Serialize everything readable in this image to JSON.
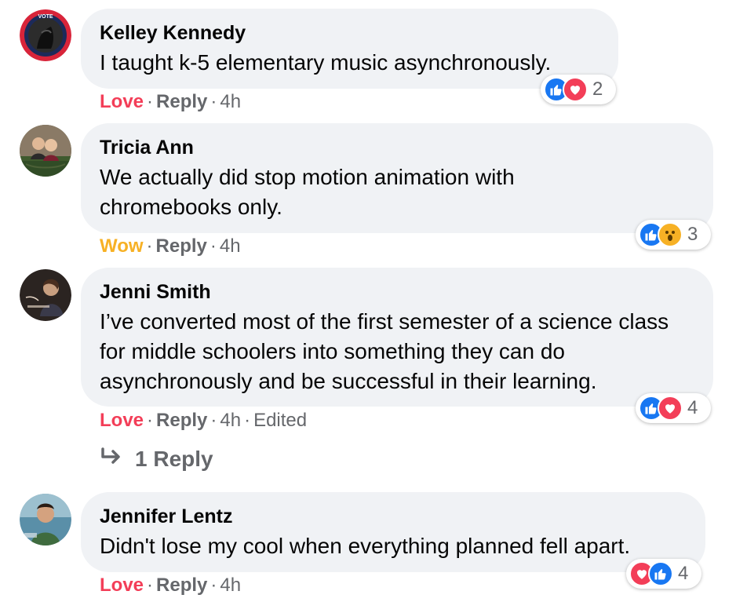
{
  "comments": [
    {
      "author": "Kelley Kennedy",
      "text": "I taught k-5 elementary music asynchronously.",
      "reaction_label": "Love",
      "reply_label": "Reply",
      "time": "4h",
      "edited": "",
      "reaction_icons": [
        "like",
        "love"
      ],
      "reaction_count": "2",
      "avatar_badge": "VOTE"
    },
    {
      "author": "Tricia Ann",
      "text": "We actually did stop motion animation with chromebooks only.",
      "reaction_label": "Wow",
      "reply_label": "Reply",
      "time": "4h",
      "edited": "",
      "reaction_icons": [
        "like",
        "wow"
      ],
      "reaction_count": "3"
    },
    {
      "author": "Jenni Smith",
      "text": "I’ve converted most of the first semester of a science class for middle schoolers into something they can do asynchronously and be successful in their learning.",
      "reaction_label": "Love",
      "reply_label": "Reply",
      "time": "4h",
      "edited": "Edited",
      "reaction_icons": [
        "like",
        "love"
      ],
      "reaction_count": "4",
      "replies_link": "1 Reply"
    },
    {
      "author": "Jennifer Lentz",
      "text": "Didn't lose my cool when everything planned fell apart.",
      "reaction_label": "Love",
      "reply_label": "Reply",
      "time": "4h",
      "edited": "",
      "reaction_icons": [
        "love",
        "like"
      ],
      "reaction_count": "4"
    }
  ],
  "colors": {
    "bubble": "#f0f2f5",
    "love": "#f33e58",
    "wow": "#f7b125",
    "like": "#1877f2",
    "secondary_text": "#65676b"
  }
}
